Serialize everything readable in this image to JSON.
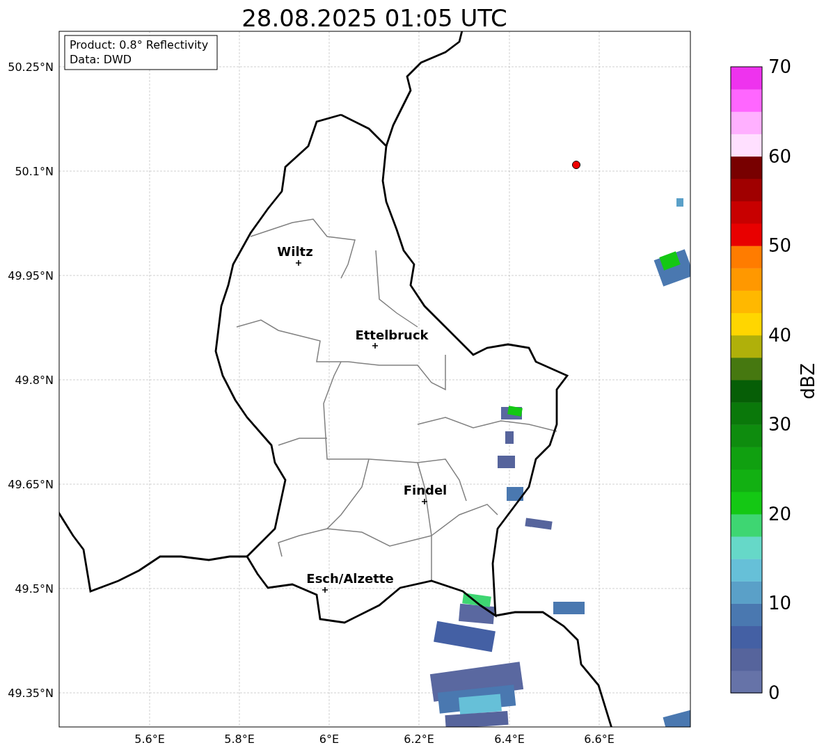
{
  "title": "28.08.2025 01:05 UTC",
  "info_box": [
    "Product: 0.8° Reflectivity",
    "Data: DWD"
  ],
  "lat_labels": [
    "50.25°N",
    "50.1°N",
    "49.95°N",
    "49.8°N",
    "49.65°N",
    "49.5°N",
    "49.35°N"
  ],
  "lon_labels": [
    "5.6°E",
    "5.8°E",
    "6°E",
    "6.2°E",
    "6.4°E",
    "6.6°E"
  ],
  "cities": [
    "Wiltz",
    "Ettelbruck",
    "Findel",
    "Esch/Alzette"
  ],
  "colorbar": {
    "label": "dBZ",
    "ticks": [
      "70",
      "60",
      "50",
      "40",
      "30",
      "20",
      "10",
      "0"
    ],
    "segments": [
      {
        "color": "#6673a8"
      },
      {
        "color": "#56649c"
      },
      {
        "color": "#4460a4"
      },
      {
        "color": "#4a78b0"
      },
      {
        "color": "#5aa0c8"
      },
      {
        "color": "#66c0d8"
      },
      {
        "color": "#66d8c8"
      },
      {
        "color": "#3ed672"
      },
      {
        "color": "#14c814"
      },
      {
        "color": "#12b012"
      },
      {
        "color": "#10a010"
      },
      {
        "color": "#0e8c0e"
      },
      {
        "color": "#0a780a"
      },
      {
        "color": "#065e06"
      },
      {
        "color": "#467810"
      },
      {
        "color": "#b0b00a"
      },
      {
        "color": "#ffd600"
      },
      {
        "color": "#ffb800"
      },
      {
        "color": "#ff9800"
      },
      {
        "color": "#ff7c00"
      },
      {
        "color": "#e80000"
      },
      {
        "color": "#c80000"
      },
      {
        "color": "#a00000"
      },
      {
        "color": "#780000"
      },
      {
        "color": "#ffe0ff"
      },
      {
        "color": "#ffb0ff"
      },
      {
        "color": "#ff66ff"
      },
      {
        "color": "#ee33ee"
      }
    ]
  }
}
